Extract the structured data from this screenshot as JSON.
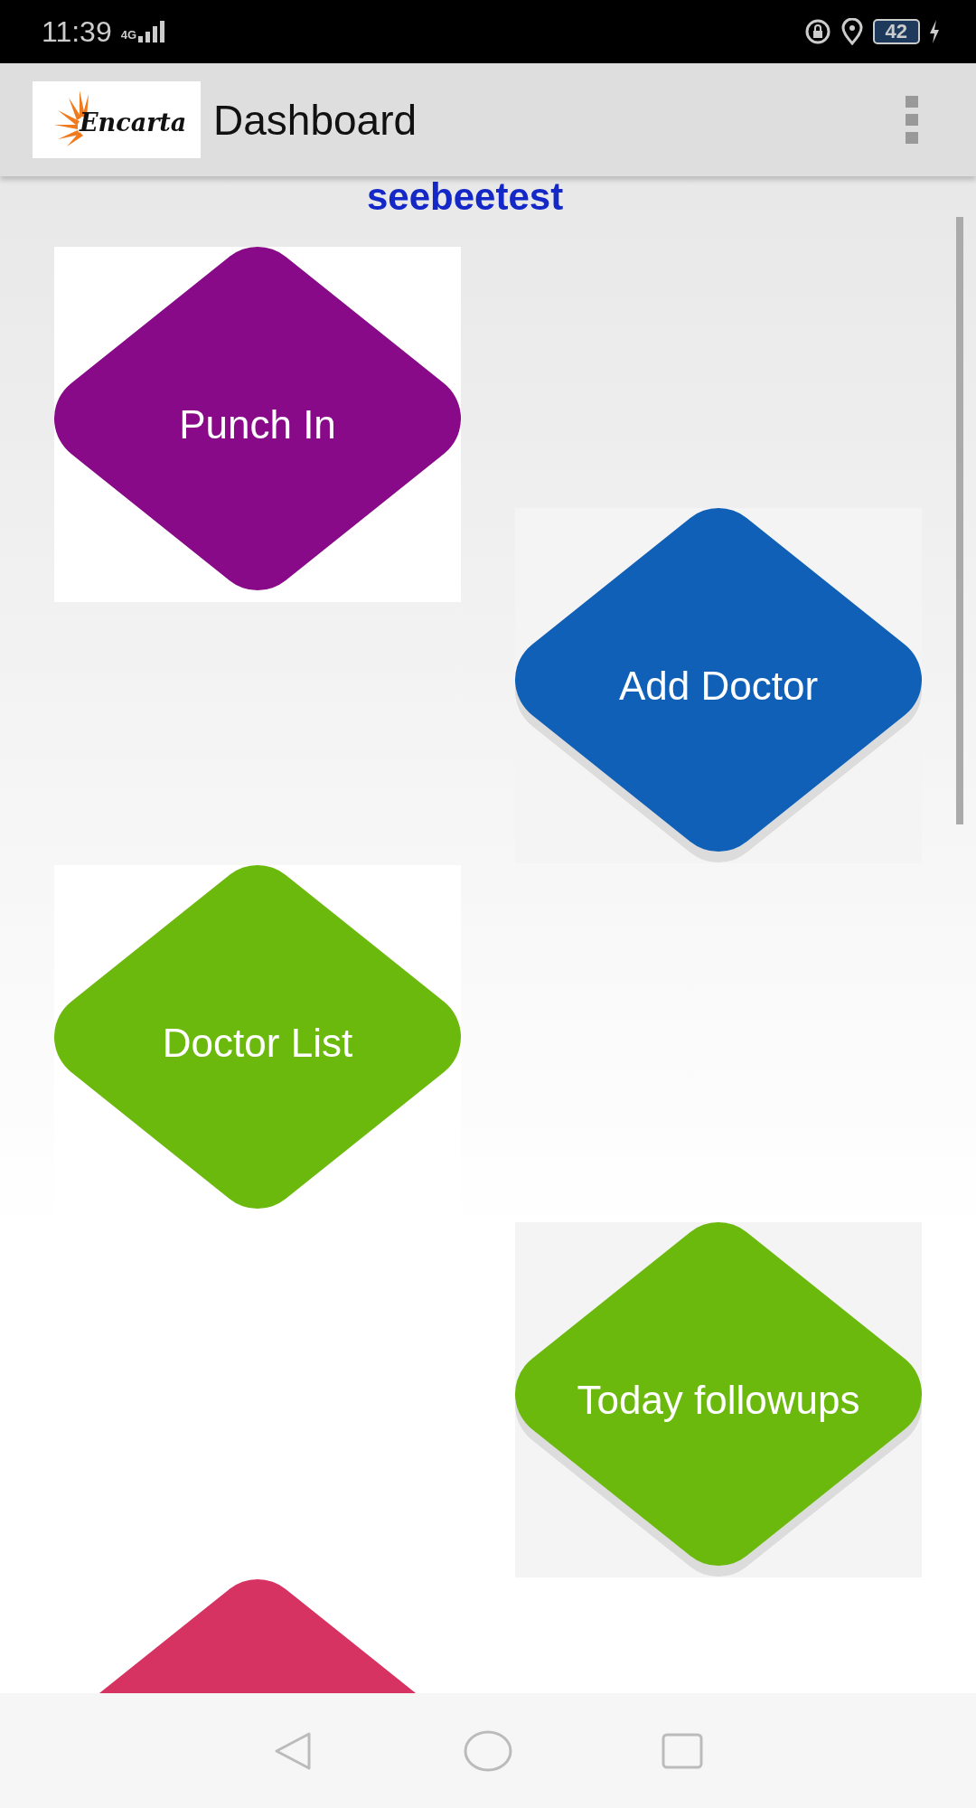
{
  "status_bar": {
    "time": "11:39",
    "network": "4G",
    "battery": "42"
  },
  "app_bar": {
    "title": "Dashboard",
    "logo_text": "Encarta"
  },
  "user_name": "seebeetest",
  "tiles": [
    {
      "label": "Punch In",
      "color": "#880a88",
      "raised": false
    },
    {
      "label": "Add Doctor",
      "color": "#1060b8",
      "raised": true
    },
    {
      "label": "Doctor List",
      "color": "#6cb90e",
      "raised": false
    },
    {
      "label": "Today followups",
      "color": "#6cb90e",
      "raised": true
    },
    {
      "color": "#d63262"
    }
  ]
}
